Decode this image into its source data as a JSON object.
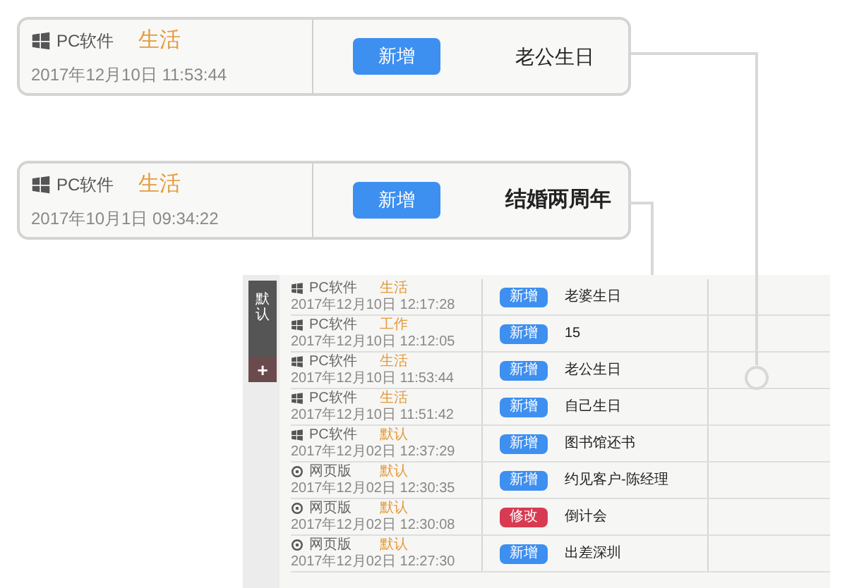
{
  "cards": [
    {
      "source": {
        "kind": "pc",
        "label": "PC软件"
      },
      "category": "生活",
      "time": "2017年12月10日 11:53:44",
      "button": {
        "kind": "add",
        "label": "新增"
      },
      "title": "老公生日"
    },
    {
      "source": {
        "kind": "pc",
        "label": "PC软件"
      },
      "category": "生活",
      "time": "2017年10月1日 09:34:22",
      "button": {
        "kind": "add",
        "label": "新增"
      },
      "title": "结婚两周年"
    }
  ],
  "list": {
    "sidebar": {
      "label": "默认",
      "add": "+"
    },
    "rows": [
      {
        "source": {
          "kind": "pc",
          "label": "PC软件"
        },
        "category": "生活",
        "time": "2017年12月10日 12:17:28",
        "button": {
          "kind": "add",
          "label": "新增"
        },
        "title": "老婆生日"
      },
      {
        "source": {
          "kind": "pc",
          "label": "PC软件"
        },
        "category": "工作",
        "time": "2017年12月10日 12:12:05",
        "button": {
          "kind": "add",
          "label": "新增"
        },
        "title": "15"
      },
      {
        "source": {
          "kind": "pc",
          "label": "PC软件"
        },
        "category": "生活",
        "time": "2017年12月10日 11:53:44",
        "button": {
          "kind": "add",
          "label": "新增"
        },
        "title": "老公生日"
      },
      {
        "source": {
          "kind": "pc",
          "label": "PC软件"
        },
        "category": "生活",
        "time": "2017年12月10日 11:51:42",
        "button": {
          "kind": "add",
          "label": "新增"
        },
        "title": "自己生日"
      },
      {
        "source": {
          "kind": "pc",
          "label": "PC软件"
        },
        "category": "默认",
        "time": "2017年12月02日 12:37:29",
        "button": {
          "kind": "add",
          "label": "新增"
        },
        "title": "图书馆还书"
      },
      {
        "source": {
          "kind": "web",
          "label": "网页版"
        },
        "category": "默认",
        "time": "2017年12月02日 12:30:35",
        "button": {
          "kind": "add",
          "label": "新增"
        },
        "title": "约见客户-陈经理"
      },
      {
        "source": {
          "kind": "web",
          "label": "网页版"
        },
        "category": "默认",
        "time": "2017年12月02日 12:30:08",
        "button": {
          "kind": "edit",
          "label": "修改"
        },
        "title": "倒计会"
      },
      {
        "source": {
          "kind": "web",
          "label": "网页版"
        },
        "category": "默认",
        "time": "2017年12月02日 12:27:30",
        "button": {
          "kind": "add",
          "label": "新增"
        },
        "title": "出差深圳"
      }
    ]
  }
}
